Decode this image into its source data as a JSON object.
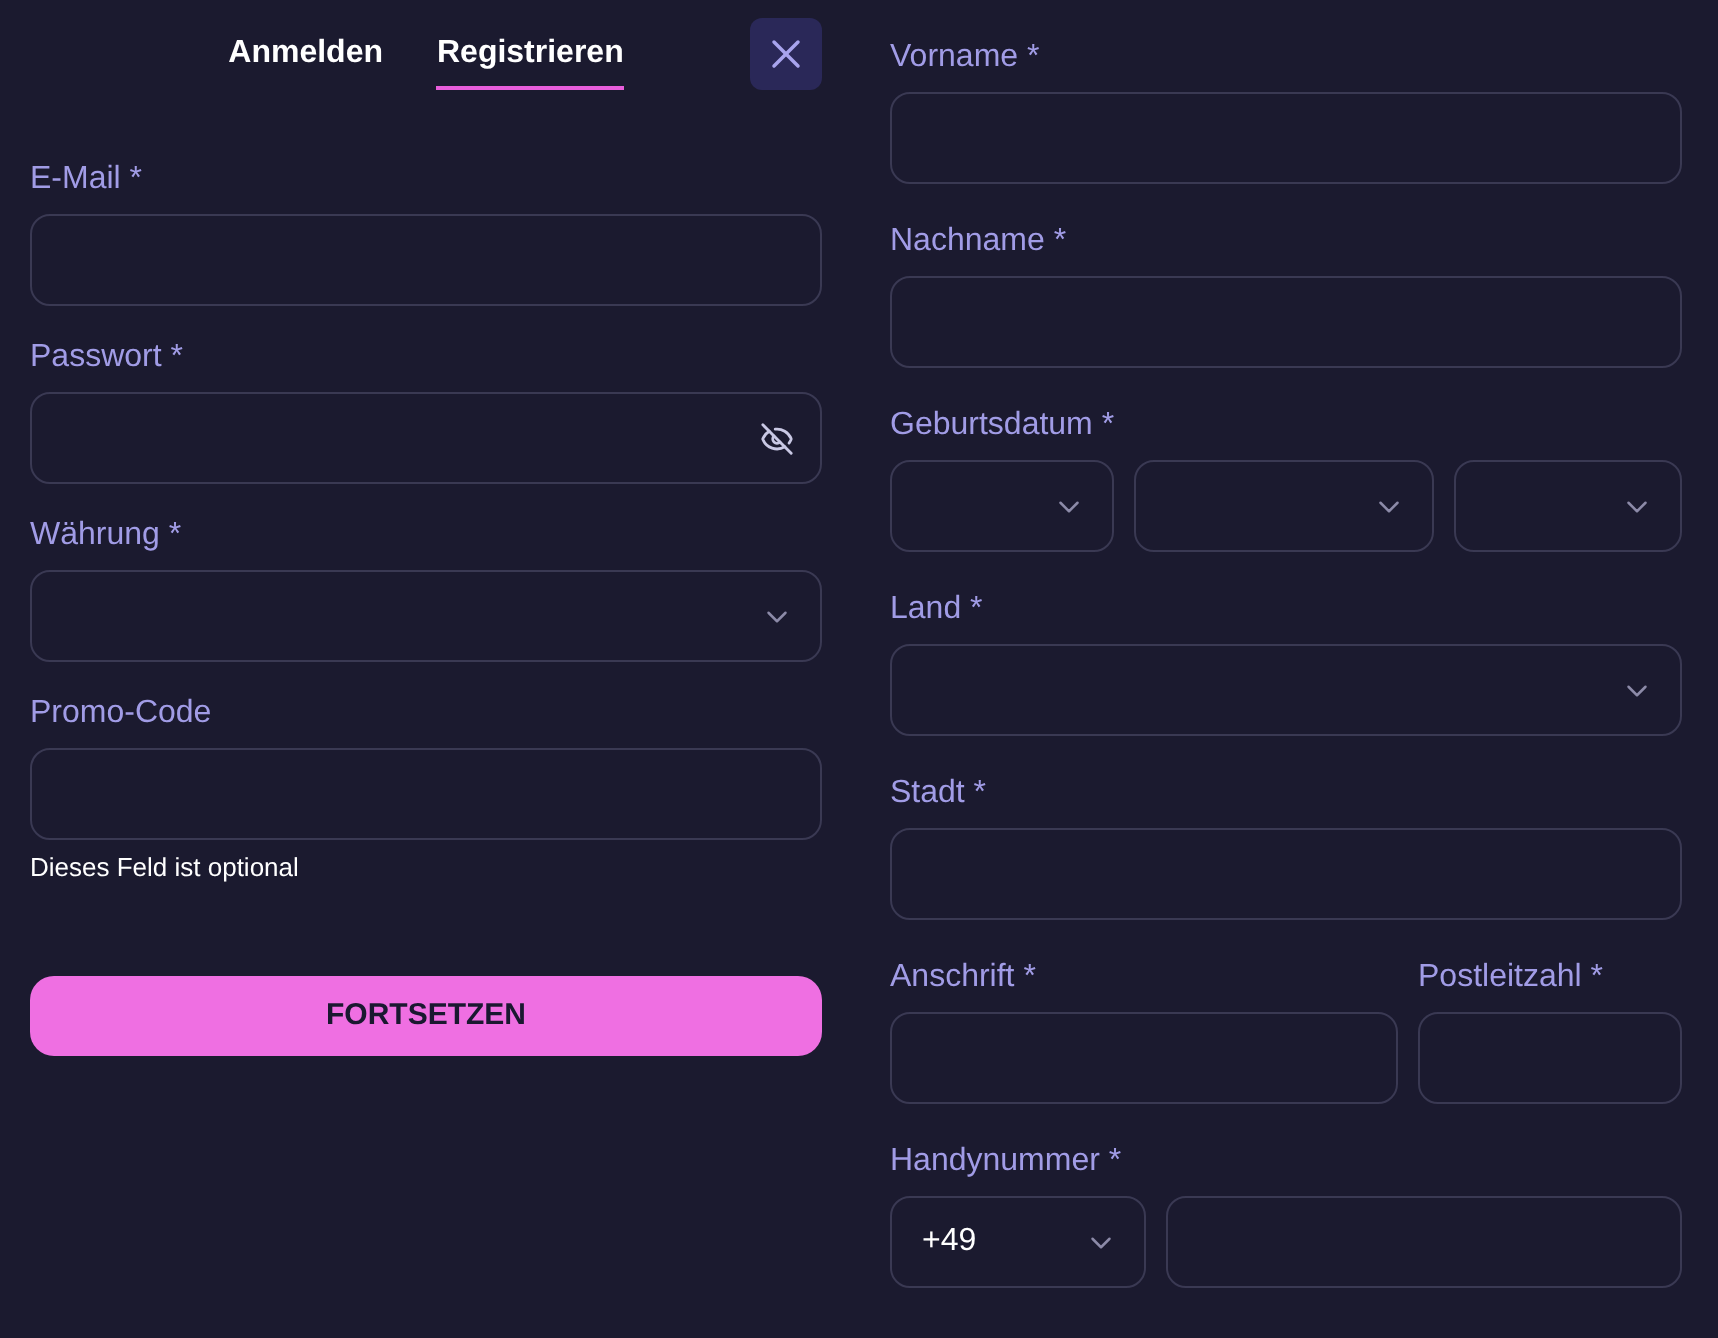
{
  "tabs": [
    {
      "label": "Anmelden",
      "selected": false
    },
    {
      "label": "Registrieren",
      "selected": true
    }
  ],
  "account_form": {
    "fields": [
      {
        "label": "E-Mail *",
        "kind": "text"
      },
      {
        "label": "Passwort *",
        "kind": "password"
      },
      {
        "label": "Währung *",
        "kind": "select"
      },
      {
        "label": "Promo-Code",
        "kind": "text",
        "note": "Dieses Feld ist optional"
      }
    ],
    "submit_button": "FORTSETZEN"
  },
  "personal_form": {
    "rows": [
      {
        "groups": [
          {
            "label": "Vorname *",
            "controls": [
              {
                "kind": "text"
              }
            ]
          }
        ]
      },
      {
        "groups": [
          {
            "label": "Nachname *",
            "controls": [
              {
                "kind": "text"
              }
            ]
          }
        ]
      },
      {
        "groups": [
          {
            "label": "Geburtsdatum *",
            "controls": [
              {
                "kind": "select"
              },
              {
                "kind": "select"
              },
              {
                "kind": "select"
              }
            ]
          }
        ]
      },
      {
        "groups": [
          {
            "label": "Land *",
            "controls": [
              {
                "kind": "select"
              }
            ]
          }
        ]
      },
      {
        "groups": [
          {
            "label": "Stadt *",
            "controls": [
              {
                "kind": "text"
              }
            ]
          }
        ]
      },
      {
        "groups": [
          {
            "label": "Anschrift *",
            "controls": [
              {
                "kind": "text"
              }
            ]
          },
          {
            "label": "Postleitzahl *",
            "controls": [
              {
                "kind": "text"
              }
            ]
          }
        ]
      },
      {
        "groups": [
          {
            "label": "Handynummer *",
            "controls": [
              {
                "kind": "select",
                "value": "+49"
              },
              {
                "kind": "text"
              }
            ]
          }
        ]
      }
    ]
  }
}
